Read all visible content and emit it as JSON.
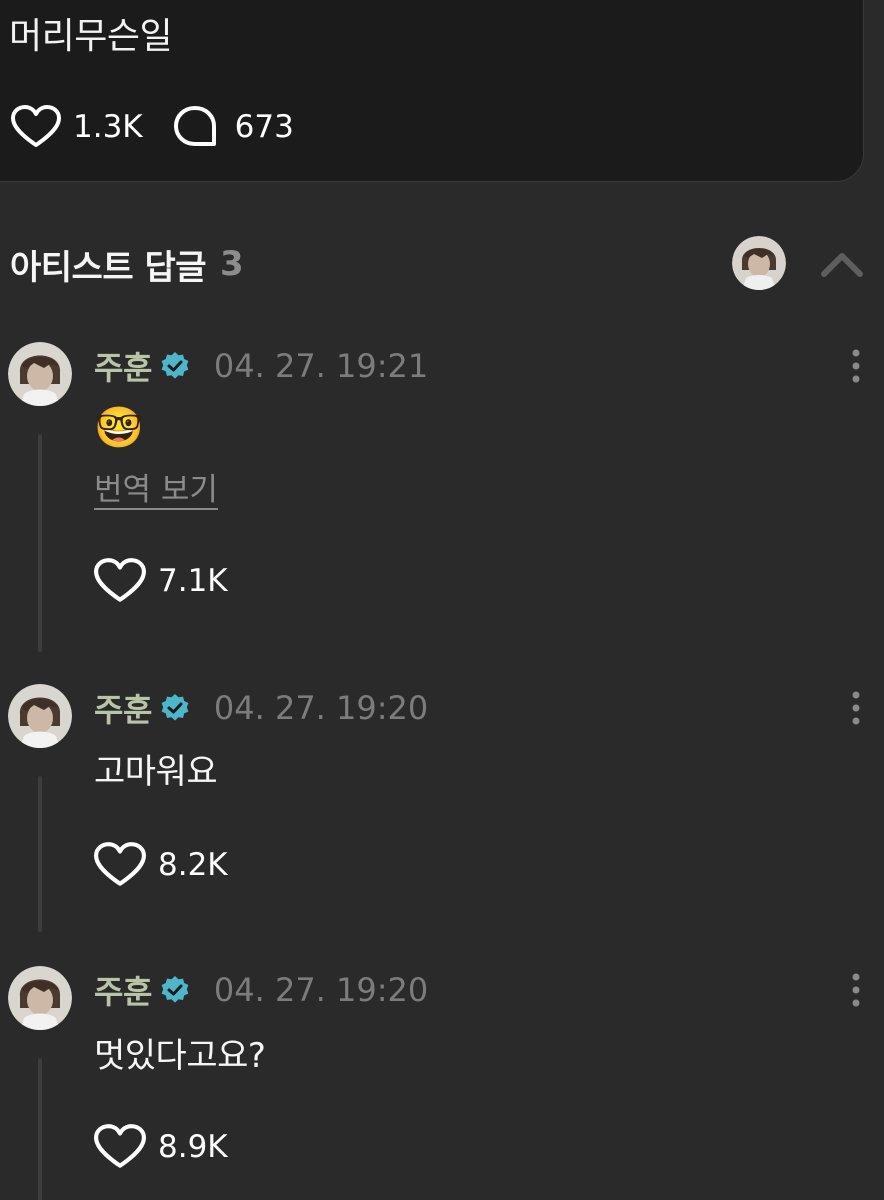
{
  "post": {
    "text": "머리무슨일",
    "likes": "1.3K",
    "comments": "673"
  },
  "section": {
    "title": "아티스트 답글",
    "count": "3"
  },
  "icons": {
    "like": "heart-outline-icon",
    "comment": "speech-bubble-icon",
    "verified": "verified-badge-icon",
    "more": "more-vertical-icon",
    "collapse": "chevron-up-icon"
  },
  "colors": {
    "background": "#2a2a2a",
    "card": "#1b1b1b",
    "name": "#b7c5a6",
    "verified": "#4db6c9",
    "muted": "#7c7c7c"
  },
  "comments": [
    {
      "author": "주훈",
      "time": "04. 27. 19:21",
      "body": "🤓",
      "translate": "번역 보기",
      "likes": "7.1K"
    },
    {
      "author": "주훈",
      "time": "04. 27. 19:20",
      "body": "고마워요",
      "likes": "8.2K"
    },
    {
      "author": "주훈",
      "time": "04. 27. 19:20",
      "body": "멋있다고요?",
      "likes": "8.9K"
    }
  ]
}
